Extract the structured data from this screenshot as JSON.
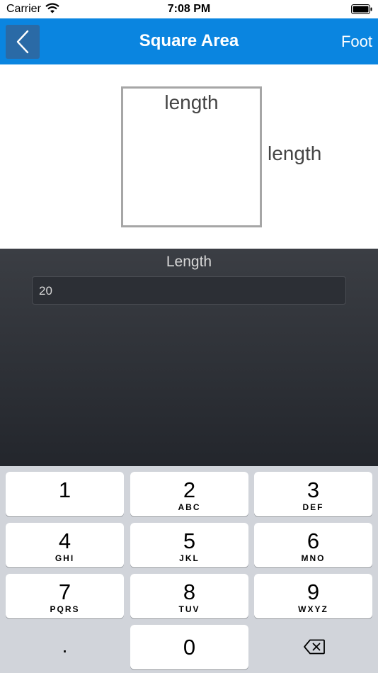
{
  "status_bar": {
    "carrier": "Carrier",
    "time": "7:08 PM"
  },
  "nav": {
    "title": "Square Area",
    "unit": "Foot",
    "back_icon": "chevron-left-icon"
  },
  "diagram": {
    "top_label": "length",
    "side_label": "length"
  },
  "form": {
    "length_label": "Length",
    "length_value": "20"
  },
  "keypad": {
    "keys": [
      {
        "digit": "1",
        "letters": ""
      },
      {
        "digit": "2",
        "letters": "ABC"
      },
      {
        "digit": "3",
        "letters": "DEF"
      },
      {
        "digit": "4",
        "letters": "GHI"
      },
      {
        "digit": "5",
        "letters": "JKL"
      },
      {
        "digit": "6",
        "letters": "MNO"
      },
      {
        "digit": "7",
        "letters": "PQRS"
      },
      {
        "digit": "8",
        "letters": "TUV"
      },
      {
        "digit": "9",
        "letters": "WXYZ"
      }
    ],
    "dot": ".",
    "zero": "0",
    "delete_icon": "backspace-icon"
  },
  "colors": {
    "nav_bar": "#0a85e0",
    "back_button": "#2a6aa6",
    "panel_top": "#3b3e44",
    "panel_bottom": "#23262c",
    "keypad_bg": "#d1d4da"
  }
}
